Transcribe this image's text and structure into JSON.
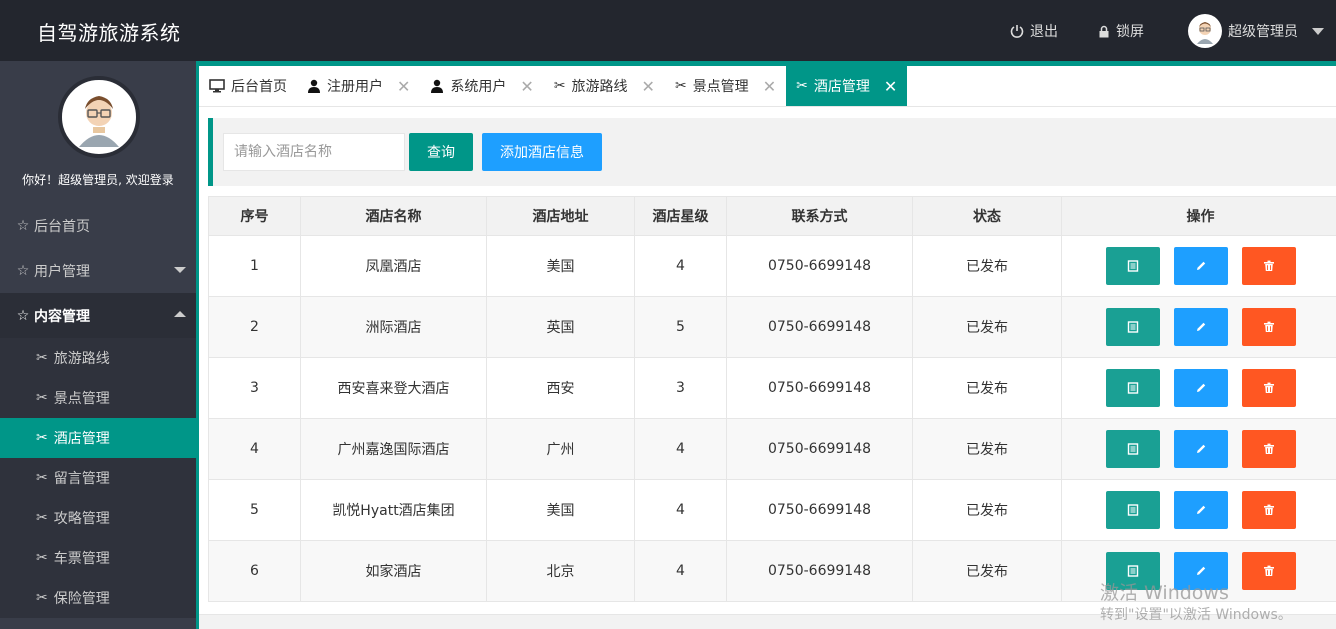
{
  "header": {
    "title": "自驾游旅游系统",
    "logout_label": "退出",
    "lock_label": "锁屏",
    "user_label": "超级管理员"
  },
  "sidebar": {
    "welcome": "你好！超级管理员, 欢迎登录",
    "items": [
      {
        "label": "后台首页",
        "icon": "star-outline-icon"
      },
      {
        "label": "用户管理",
        "icon": "star-outline-icon"
      },
      {
        "label": "内容管理",
        "icon": "star-outline-icon"
      }
    ],
    "sub_items": [
      {
        "label": "旅游路线",
        "icon": "tools-icon"
      },
      {
        "label": "景点管理",
        "icon": "tools-icon"
      },
      {
        "label": "酒店管理",
        "icon": "tools-icon"
      },
      {
        "label": "留言管理",
        "icon": "tools-icon"
      },
      {
        "label": "攻略管理",
        "icon": "tools-icon"
      },
      {
        "label": "车票管理",
        "icon": "tools-icon"
      },
      {
        "label": "保险管理",
        "icon": "tools-icon"
      }
    ]
  },
  "tabs": [
    {
      "label": "后台首页",
      "icon": "monitor-icon"
    },
    {
      "label": "注册用户",
      "icon": "user-icon"
    },
    {
      "label": "系统用户",
      "icon": "user-icon"
    },
    {
      "label": "旅游路线",
      "icon": "tools-icon"
    },
    {
      "label": "景点管理",
      "icon": "tools-icon"
    },
    {
      "label": "酒店管理",
      "icon": "tools-icon"
    }
  ],
  "search": {
    "placeholder": "请输入酒店名称",
    "query_label": "查询",
    "add_label": "添加酒店信息"
  },
  "table": {
    "headers": [
      "序号",
      "酒店名称",
      "酒店地址",
      "酒店星级",
      "联系方式",
      "状态",
      "操作"
    ],
    "rows": [
      {
        "no": "1",
        "name": "凤凰酒店",
        "address": "美国",
        "stars": "4",
        "phone": "0750-6699148",
        "status": "已发布"
      },
      {
        "no": "2",
        "name": "洲际酒店",
        "address": "英国",
        "stars": "5",
        "phone": "0750-6699148",
        "status": "已发布"
      },
      {
        "no": "3",
        "name": "西安喜来登大酒店",
        "address": "西安",
        "stars": "3",
        "phone": "0750-6699148",
        "status": "已发布"
      },
      {
        "no": "4",
        "name": "广州嘉逸国际酒店",
        "address": "广州",
        "stars": "4",
        "phone": "0750-6699148",
        "status": "已发布"
      },
      {
        "no": "5",
        "name": "凯悦Hyatt酒店集团",
        "address": "美国",
        "stars": "4",
        "phone": "0750-6699148",
        "status": "已发布"
      },
      {
        "no": "6",
        "name": "如家酒店",
        "address": "北京",
        "stars": "4",
        "phone": "0750-6699148",
        "status": "已发布"
      }
    ]
  },
  "watermark": {
    "line1": "激活 Windows",
    "line2": "转到\"设置\"以激活 Windows。"
  },
  "colors": {
    "accent": "#009688",
    "blue": "#1e9fff",
    "orange": "#ff5722",
    "header_bg": "#23262e",
    "sidebar_bg": "#393d49"
  }
}
